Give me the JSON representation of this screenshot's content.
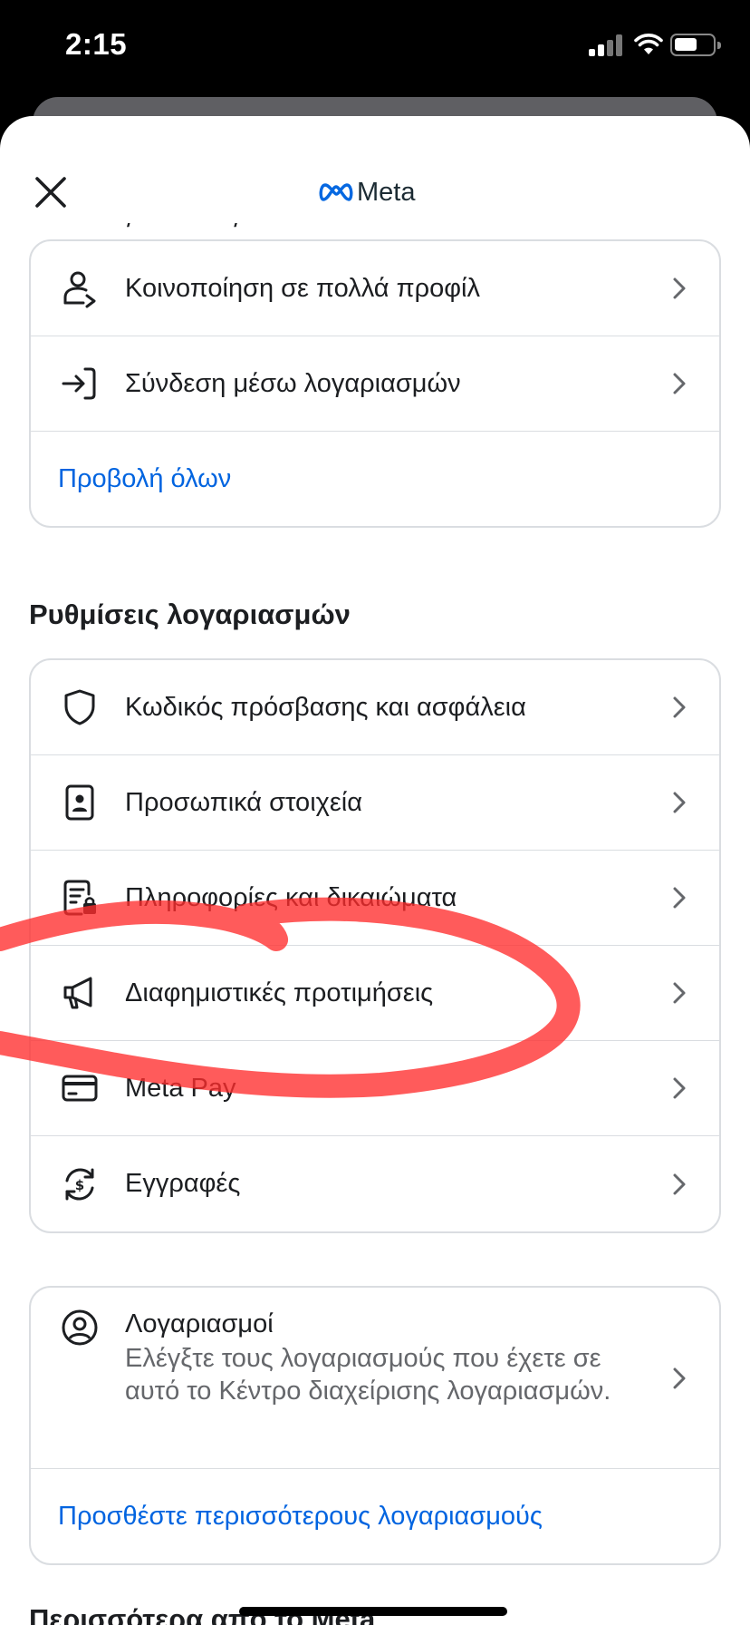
{
  "status_bar": {
    "time": "2:15"
  },
  "header": {
    "brand": "Meta",
    "close_icon": "close-icon",
    "logo_icon": "meta-infinity-icon"
  },
  "connected": {
    "items": [
      {
        "label": "Κοινοποίηση σε πολλά προφίλ",
        "icon": "person-share-icon"
      },
      {
        "label": "Σύνδεση μέσω λογαριασμών",
        "icon": "sign-in-arrow-icon"
      }
    ],
    "view_all": "Προβολή όλων"
  },
  "account_settings": {
    "title": "Ρυθμίσεις λογαριασμών",
    "items": [
      {
        "label": "Κωδικός πρόσβασης και ασφάλεια",
        "icon": "shield-icon"
      },
      {
        "label": "Προσωπικά στοιχεία",
        "icon": "id-card-icon"
      },
      {
        "label": "Πληροφορίες και δικαιώματα",
        "icon": "info-lock-icon"
      },
      {
        "label": "Διαφημιστικές προτιμήσεις",
        "icon": "megaphone-icon"
      },
      {
        "label": "Meta Pay",
        "icon": "card-icon"
      },
      {
        "label": "Εγγραφές",
        "icon": "dollar-refresh-icon"
      }
    ]
  },
  "accounts": {
    "title": "Λογαριασμοί",
    "description": "Ελέγξτε τους λογαριασμούς που έχετε σε αυτό το Κέντρο διαχείρισης λογαριασμών.",
    "add_more": "Προσθέστε περισσότερους λογαριασμούς"
  },
  "more_from": {
    "title": "Περισσότερα από το Meta"
  },
  "colors": {
    "link": "#0064e0",
    "scribble": "#ff2d2d",
    "border": "#dadde1"
  }
}
